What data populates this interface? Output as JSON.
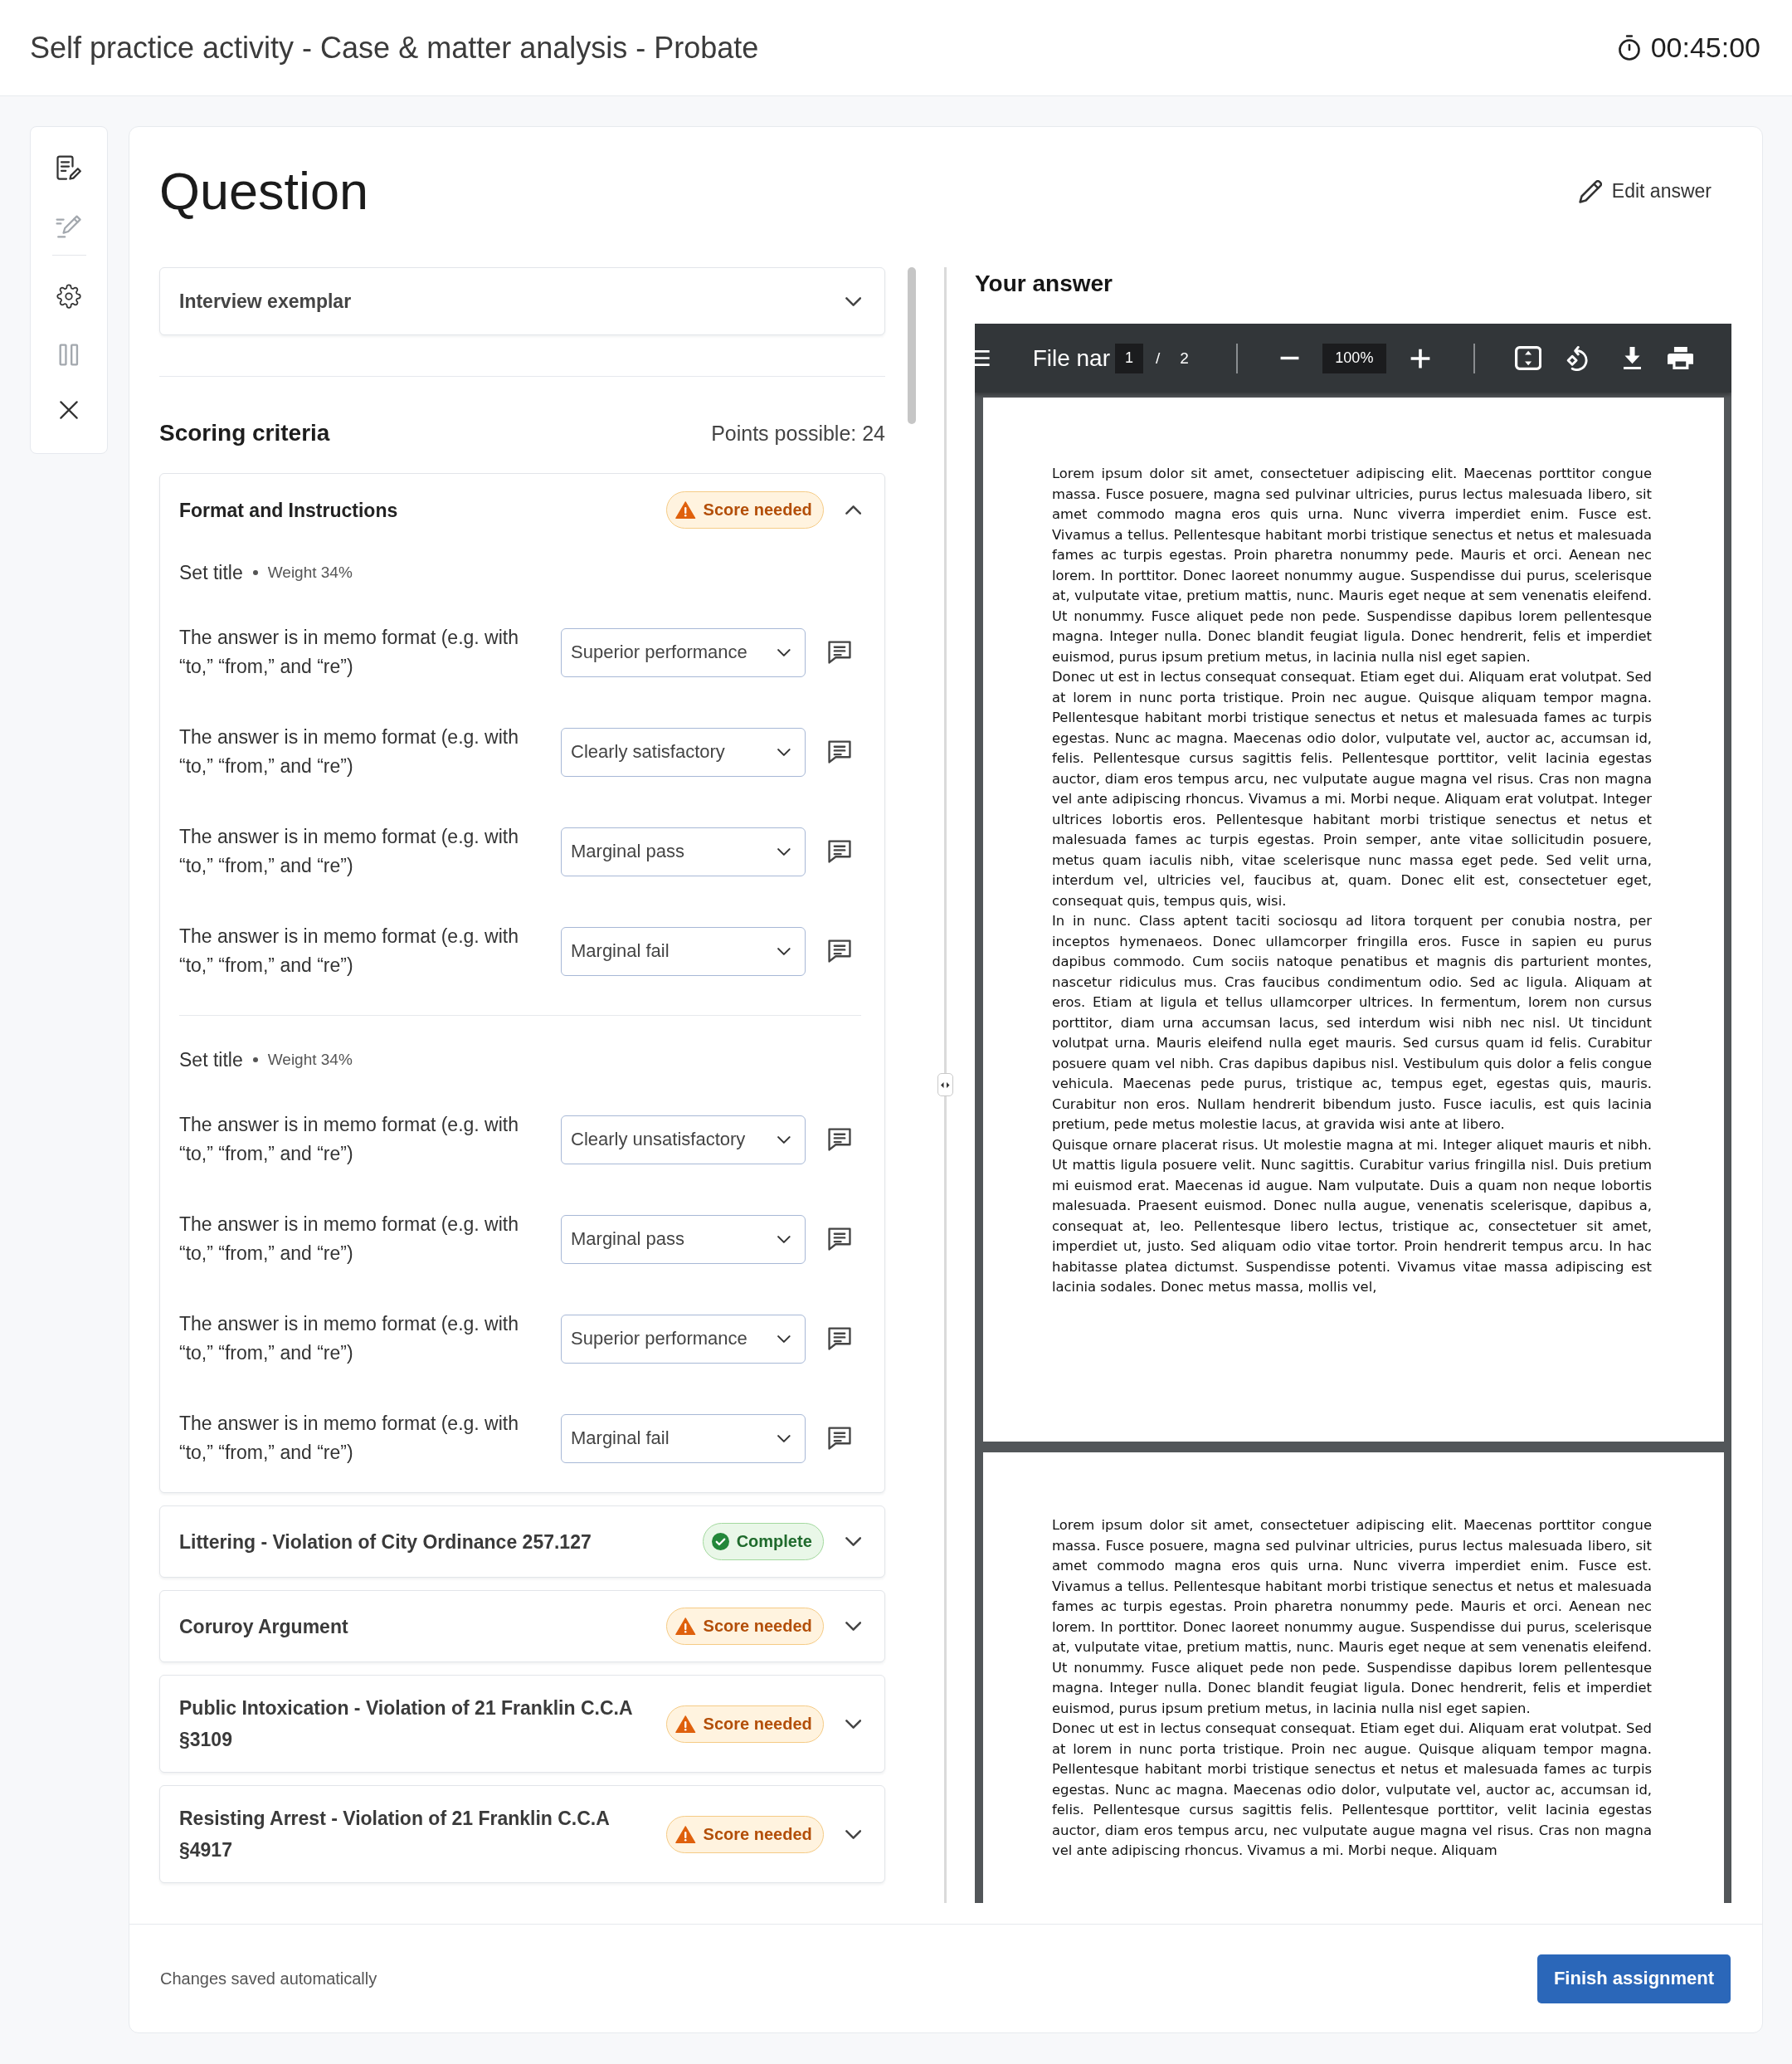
{
  "header": {
    "title": "Self practice activity - Case & matter analysis - Probate",
    "timer": "00:45:00"
  },
  "sidebar": {
    "groups": [
      [
        {
          "disabled": false
        },
        {
          "disabled": true
        }
      ],
      [
        {
          "disabled": false
        },
        {
          "disabled": true
        },
        {
          "disabled": false
        }
      ]
    ]
  },
  "question": {
    "title": "Question",
    "edit_link": "Edit answer"
  },
  "exemplar": {
    "title": "Interview exemplar",
    "expanded": false
  },
  "scoring": {
    "title": "Scoring criteria",
    "points": "Points possible: 24",
    "sections": [
      {
        "title": "Format and Instructions",
        "status": {
          "kind": "warning",
          "label": "Score needed"
        },
        "expanded": true,
        "groups": [
          {
            "title": "Set title",
            "weight": "Weight 34%",
            "criteria": [
              {
                "text": "The answer is in memo format (e.g. with “to,” “from,” and “re”)",
                "value": "Superior performance"
              },
              {
                "text": "The answer is in memo format (e.g. with “to,” “from,” and “re”)",
                "value": "Clearly satisfactory"
              },
              {
                "text": "The answer is in memo format (e.g. with “to,” “from,” and “re”)",
                "value": "Marginal pass"
              },
              {
                "text": "The answer is in memo format (e.g. with “to,” “from,” and “re”)",
                "value": "Marginal fail"
              }
            ]
          },
          {
            "title": "Set title",
            "weight": "Weight 34%",
            "criteria": [
              {
                "text": "The answer is in memo format (e.g. with “to,” “from,” and “re”)",
                "value": "Clearly unsatisfactory"
              },
              {
                "text": "The answer is in memo format (e.g. with “to,” “from,” and “re”)",
                "value": "Marginal pass"
              },
              {
                "text": "The answer is in memo format (e.g. with “to,” “from,” and “re”)",
                "value": "Superior performance"
              },
              {
                "text": "The answer is in memo format (e.g. with “to,” “from,” and “re”)",
                "value": "Marginal fail"
              }
            ]
          }
        ]
      },
      {
        "title": "Littering - Violation of City Ordinance 257.127",
        "status": {
          "kind": "success",
          "label": "Complete"
        },
        "expanded": false
      },
      {
        "title": "Coruroy Argument",
        "status": {
          "kind": "warning",
          "label": "Score needed"
        },
        "expanded": false
      },
      {
        "title": "Public Intoxication - Violation of 21 Franklin C.C.A §3109",
        "status": {
          "kind": "warning",
          "label": "Score needed"
        },
        "expanded": false
      },
      {
        "title": "Resisting Arrest - Violation of 21 Franklin C.C.A §4917",
        "status": {
          "kind": "warning",
          "label": "Score needed"
        },
        "expanded": false
      }
    ]
  },
  "answer": {
    "title": "Your answer",
    "viewer": {
      "file_name": "File nar",
      "page": "1",
      "page_separator": "/",
      "page_count": "2",
      "zoom": "100%",
      "pages": [
        {
          "paragraphs": [
            "Lorem ipsum dolor sit amet, consectetuer adipiscing elit. Maecenas porttitor congue massa. Fusce posuere, magna sed pulvinar ultricies, purus lectus malesuada libero, sit amet commodo magna eros quis urna. Nunc viverra imperdiet enim. Fusce est. Vivamus a tellus. Pellentesque habitant morbi tristique senectus et netus et malesuada fames ac turpis egestas. Proin pharetra nonummy pede. Mauris et orci. Aenean nec lorem. In porttitor. Donec laoreet nonummy augue. Suspendisse dui purus, scelerisque at, vulputate vitae, pretium mattis, nunc. Mauris eget neque at sem venenatis eleifend. Ut nonummy. Fusce aliquet pede non pede. Suspendisse dapibus lorem pellentesque magna. Integer nulla. Donec blandit feugiat ligula. Donec hendrerit, felis et imperdiet euismod, purus ipsum pretium metus, in lacinia nulla nisl eget sapien.",
            "Donec ut est in lectus consequat consequat. Etiam eget dui. Aliquam erat volutpat. Sed at lorem in nunc porta tristique. Proin nec augue. Quisque aliquam tempor magna. Pellentesque habitant morbi tristique senectus et netus et malesuada fames ac turpis egestas. Nunc ac magna. Maecenas odio dolor, vulputate vel, auctor ac, accumsan id, felis. Pellentesque cursus sagittis felis. Pellentesque porttitor, velit lacinia egestas auctor, diam eros tempus arcu, nec vulputate augue magna vel risus. Cras non magna vel ante adipiscing rhoncus. Vivamus a mi. Morbi neque. Aliquam erat volutpat. Integer ultrices lobortis eros. Pellentesque habitant morbi tristique senectus et netus et malesuada fames ac turpis egestas. Proin semper, ante vitae sollicitudin posuere, metus quam iaculis nibh, vitae scelerisque nunc massa eget pede. Sed velit urna, interdum vel, ultricies vel, faucibus at, quam. Donec elit est, consectetuer eget, consequat quis, tempus quis, wisi.",
            "In in nunc. Class aptent taciti sociosqu ad litora torquent per conubia nostra, per inceptos hymenaeos. Donec ullamcorper fringilla eros. Fusce in sapien eu purus dapibus commodo. Cum sociis natoque penatibus et magnis dis parturient montes, nascetur ridiculus mus. Cras faucibus condimentum odio. Sed ac ligula. Aliquam at eros. Etiam at ligula et tellus ullamcorper ultrices. In fermentum, lorem non cursus porttitor, diam urna accumsan lacus, sed interdum wisi nibh nec nisl. Ut tincidunt volutpat urna. Mauris eleifend nulla eget mauris. Sed cursus quam id felis. Curabitur posuere quam vel nibh. Cras dapibus dapibus nisl. Vestibulum quis dolor a felis congue vehicula. Maecenas pede purus, tristique ac, tempus eget, egestas quis, mauris. Curabitur non eros. Nullam hendrerit bibendum justo. Fusce iaculis, est quis lacinia pretium, pede metus molestie lacus, at gravida wisi ante at libero.",
            "Quisque ornare placerat risus. Ut molestie magna at mi. Integer aliquet mauris et nibh. Ut mattis ligula posuere velit. Nunc sagittis. Curabitur varius fringilla nisl. Duis pretium mi euismod erat. Maecenas id augue. Nam vulputate. Duis a quam non neque lobortis malesuada. Praesent euismod. Donec nulla augue, venenatis scelerisque, dapibus a, consequat at, leo. Pellentesque libero lectus, tristique ac, consectetuer sit amet, imperdiet ut, justo. Sed aliquam odio vitae tortor. Proin hendrerit tempus arcu. In hac habitasse platea dictumst. Suspendisse potenti. Vivamus vitae massa adipiscing est lacinia sodales. Donec metus massa, mollis vel,"
          ]
        },
        {
          "paragraphs": [
            "Lorem ipsum dolor sit amet, consectetuer adipiscing elit. Maecenas porttitor congue massa. Fusce posuere, magna sed pulvinar ultricies, purus lectus malesuada libero, sit amet commodo magna eros quis urna. Nunc viverra imperdiet enim. Fusce est. Vivamus a tellus. Pellentesque habitant morbi tristique senectus et netus et malesuada fames ac turpis egestas. Proin pharetra nonummy pede. Mauris et orci. Aenean nec lorem. In porttitor. Donec laoreet nonummy augue. Suspendisse dui purus, scelerisque at, vulputate vitae, pretium mattis, nunc. Mauris eget neque at sem venenatis eleifend. Ut nonummy. Fusce aliquet pede non pede. Suspendisse dapibus lorem pellentesque magna. Integer nulla. Donec blandit feugiat ligula. Donec hendrerit, felis et imperdiet euismod, purus ipsum pretium metus, in lacinia nulla nisl eget sapien.",
            "Donec ut est in lectus consequat consequat. Etiam eget dui. Aliquam erat volutpat. Sed at lorem in nunc porta tristique. Proin nec augue. Quisque aliquam tempor magna. Pellentesque habitant morbi tristique senectus et netus et malesuada fames ac turpis egestas. Nunc ac magna. Maecenas odio dolor, vulputate vel, auctor ac, accumsan id, felis. Pellentesque cursus sagittis felis. Pellentesque porttitor, velit lacinia egestas auctor, diam eros tempus arcu, nec vulputate augue magna vel risus. Cras non magna vel ante adipiscing rhoncus. Vivamus a mi. Morbi neque. Aliquam"
          ]
        }
      ]
    }
  },
  "footer": {
    "status": "Changes saved automatically",
    "finish_button": "Finish assignment"
  }
}
